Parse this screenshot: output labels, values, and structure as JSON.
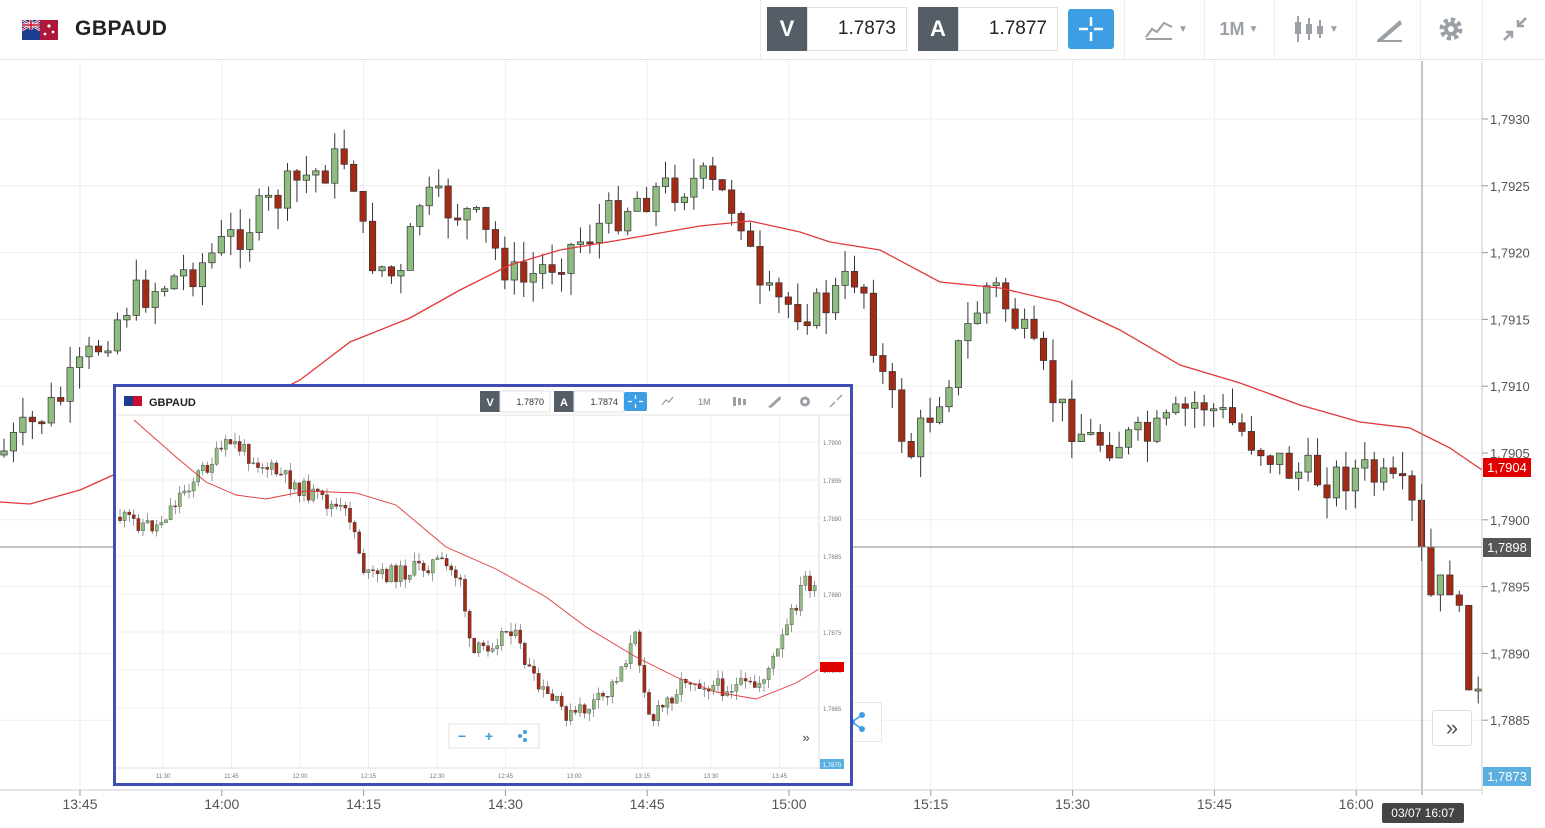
{
  "toolbar": {
    "symbol": "GBPAUD",
    "bid_label": "V",
    "bid_value": "1.7873",
    "ask_label": "A",
    "ask_value": "1.7877",
    "timeframe": "1M",
    "icons": [
      "flag-gb-au",
      "crosshair-icon",
      "chart-type-icon",
      "candlestick-icon",
      "drawing-tools-icon",
      "gear-icon",
      "collapse-icon"
    ]
  },
  "chart": {
    "price_ticks": [
      "1,7930",
      "1,7925",
      "1,7920",
      "1,7915",
      "1,7910",
      "1,7905",
      "1,7900",
      "1,7895",
      "1,7890",
      "1,7885"
    ],
    "time_ticks": [
      "13:45",
      "14:00",
      "14:15",
      "14:30",
      "14:45",
      "15:00",
      "15:15",
      "15:30",
      "15:45",
      "16:00"
    ],
    "current_price_tag": "1,7904",
    "crosshair_price_tag": "1,7898",
    "bid_price_tag": "1,7873",
    "crosshair_time_tag": "03/07 16:07",
    "scroll_button": "»",
    "colors": {
      "up": "#8fbc7f",
      "down": "#a52a16",
      "ma": "#e0383b",
      "price_tag": "#e00000",
      "bid_tag": "#5bb0e0",
      "crosshair_tag": "#555"
    }
  },
  "inset": {
    "symbol": "GBPAUD",
    "bid_label": "V",
    "bid_value": "1.7870",
    "ask_label": "A",
    "ask_value": "1.7874",
    "timeframe": "1M",
    "price_ticks": [
      "1,7900",
      "1,7895",
      "1,7890",
      "1,7885",
      "1,7880",
      "1,7875",
      "1,7870",
      "1,7865"
    ],
    "time_ticks": [
      "11:30",
      "11:45",
      "12:00",
      "12:15",
      "12:30",
      "12:45",
      "13:00",
      "13:15",
      "13:30",
      "13:45"
    ],
    "zoom_out": "−",
    "zoom_in": "+",
    "scroll_button": "»",
    "bid_price_tag": "1,7870"
  }
}
